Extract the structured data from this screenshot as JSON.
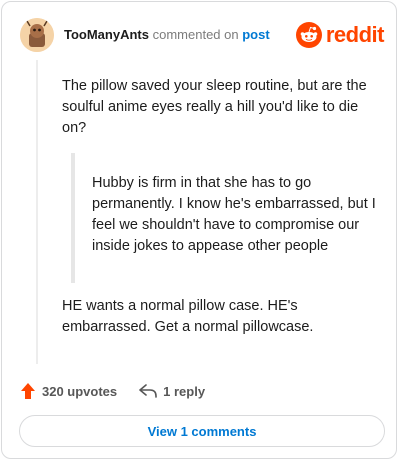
{
  "header": {
    "username": "TooManyAnts",
    "action_text": "commented on",
    "post_link": "post",
    "brand": "reddit"
  },
  "comment": {
    "paragraph1": "The pillow saved your sleep routine, but are the soulful anime eyes really a hill you'd like to die on?",
    "quote": "Hubby is firm in that she has to go permanently. I know he's embarrassed, but I feel we shouldn't have to compromise our inside jokes to appease other people",
    "paragraph2": "HE wants a normal pillow case. HE's embarrassed. Get a normal pillowcase."
  },
  "actions": {
    "upvotes": "320 upvotes",
    "replies": "1 reply"
  },
  "footer": {
    "view_comments": "View 1 comments"
  },
  "colors": {
    "brand": "#ff4500",
    "link": "#0079d3"
  }
}
